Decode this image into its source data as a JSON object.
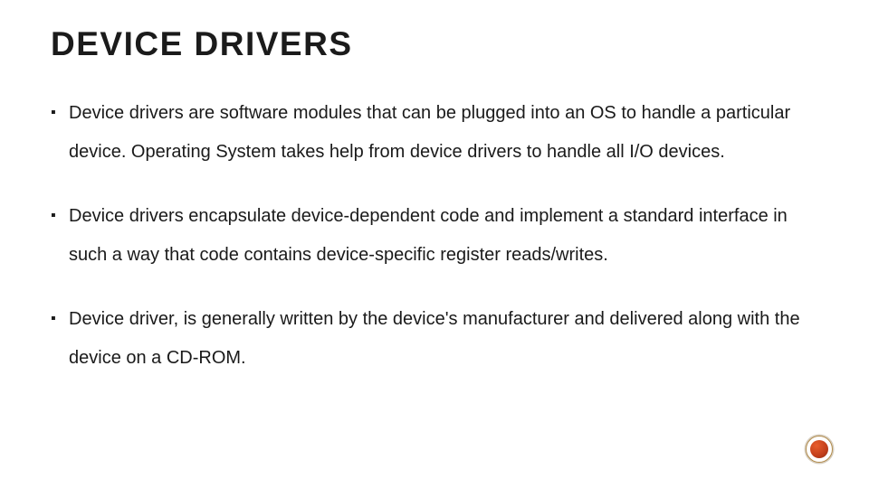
{
  "title": "DEVICE DRIVERS",
  "bullets": [
    "Device drivers are software modules that can be plugged into an OS to handle a particular device. Operating System takes help from device drivers to handle all I/O devices.",
    "Device drivers encapsulate device-dependent code and implement a standard interface in such a way that code contains device-specific register reads/writes.",
    "Device driver, is generally written by the device's manufacturer and delivered along with the device on a CD-ROM."
  ]
}
